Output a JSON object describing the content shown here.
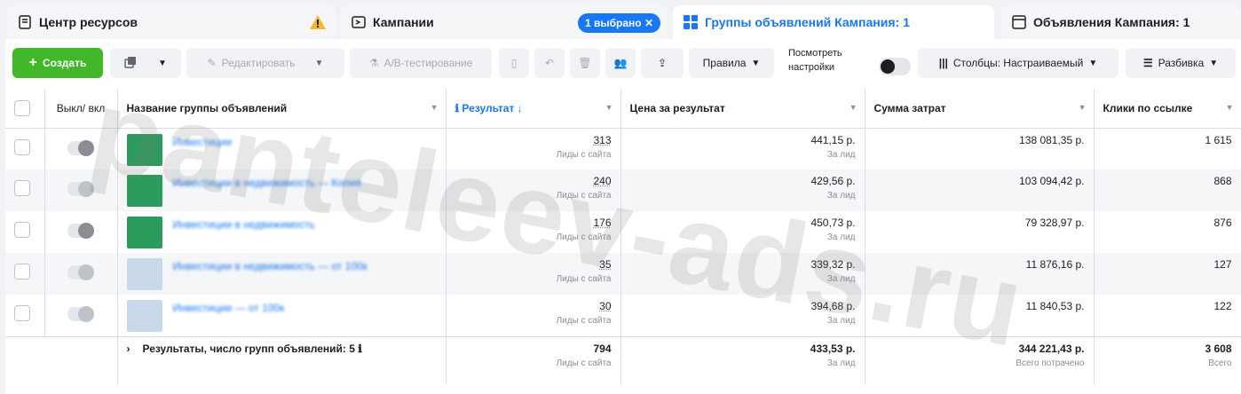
{
  "tabs": {
    "resources": {
      "label": "Центр ресурсов"
    },
    "campaigns": {
      "label": "Кампании",
      "badge": "1 выбрано ✕"
    },
    "adsets": {
      "label": "Группы объявлений Кампания: 1"
    },
    "ads": {
      "label": "Объявления Кампания: 1"
    }
  },
  "toolbar": {
    "create": "Создать",
    "edit": "Редактировать",
    "ab_test": "A/B-тестирование",
    "rules": "Правила",
    "view_settings": [
      "Посмотреть",
      "настройки"
    ],
    "columns": "Столбцы: Настраиваемый",
    "breakdown": "Разбивка"
  },
  "headers": {
    "toggle": "Выкл/ вкл",
    "name": "Название группы объявлений",
    "result": "Результат ↓",
    "cpr": "Цена за результат",
    "spend": "Сумма затрат",
    "clicks": "Клики по ссылке"
  },
  "rows": [
    {
      "name": "Инвестиции",
      "result": "313",
      "result_sub": "Лиды с сайта",
      "cpr": "441,15 р.",
      "cpr_sub": "За лид",
      "spend": "138 081,35 р.",
      "clicks": "1 615"
    },
    {
      "name": "Инвестиции в недвижимость — Копия",
      "result": "240",
      "result_sub": "Лиды с сайта",
      "cpr": "429,56 р.",
      "cpr_sub": "За лид",
      "spend": "103 094,42 р.",
      "clicks": "868"
    },
    {
      "name": "Инвестиции в недвижимость",
      "result": "176",
      "result_sub": "Лиды с сайта",
      "cpr": "450,73 р.",
      "cpr_sub": "За лид",
      "spend": "79 328,97 р.",
      "clicks": "876"
    },
    {
      "name": "Инвестиции в недвижимость — от 100к",
      "result": "35",
      "result_sub": "Лиды с сайта",
      "cpr": "339,32 р.",
      "cpr_sub": "За лид",
      "spend": "11 876,16 р.",
      "clicks": "127"
    },
    {
      "name": "Инвестиции — от 100к",
      "result": "30",
      "result_sub": "Лиды с сайта",
      "cpr": "394,68 р.",
      "cpr_sub": "За лид",
      "spend": "11 840,53 р.",
      "clicks": "122"
    }
  ],
  "total": {
    "label": "Результаты, число групп объявлений: 5",
    "result": "794",
    "result_sub": "Лиды с сайта",
    "cpr": "433,53 р.",
    "cpr_sub": "За лид",
    "spend": "344 221,43 р.",
    "spend_sub": "Всего потрачено",
    "clicks": "3 608",
    "clicks_sub": "Всего"
  },
  "watermark": "panteleev-ads.ru",
  "colors": {
    "accent": "#1877f2",
    "create": "#42b72a"
  }
}
